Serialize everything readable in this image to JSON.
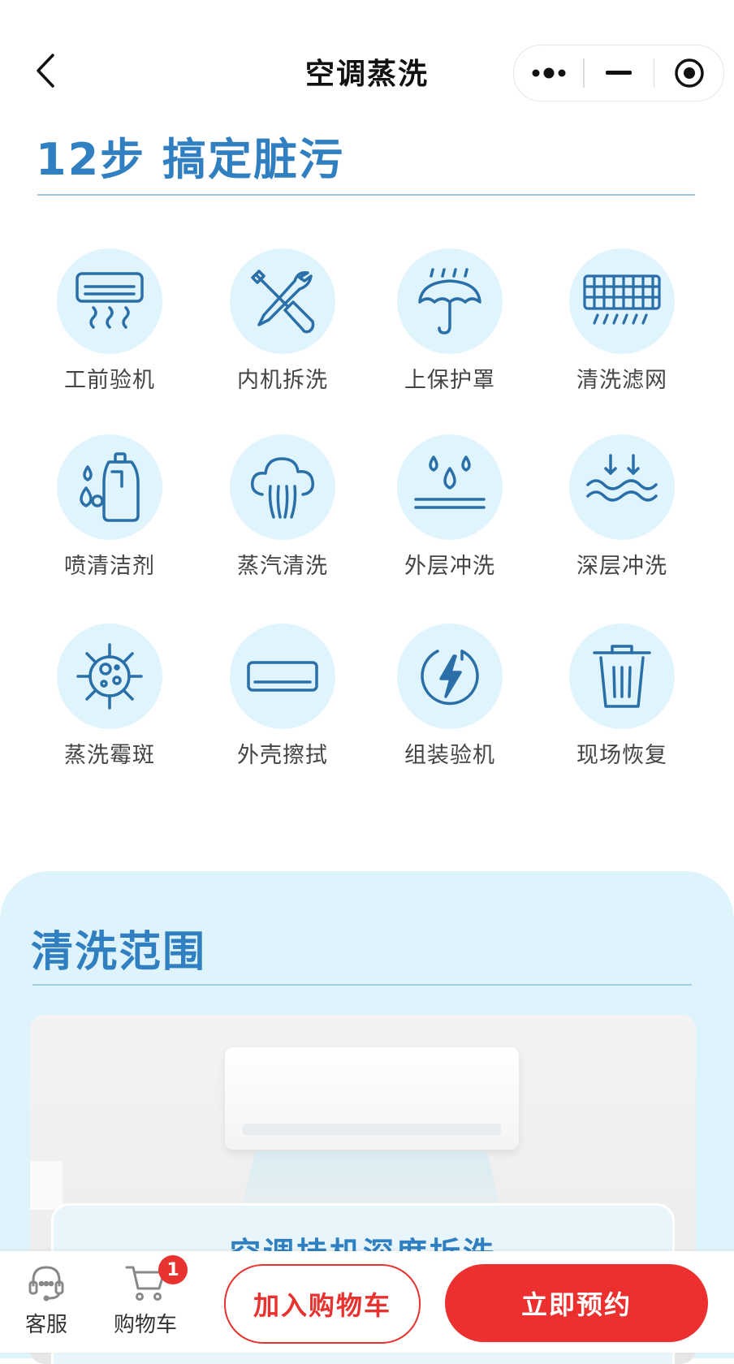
{
  "header": {
    "title": "空调蒸洗",
    "back_icon": "chevron-left-icon",
    "capsule": [
      "more-dots-icon",
      "minimize-icon",
      "target-icon"
    ]
  },
  "steps_section": {
    "title": "12步 搞定脏污",
    "steps": [
      {
        "label": "工前验机",
        "icon": "air-conditioner-heat-icon"
      },
      {
        "label": "内机拆洗",
        "icon": "tools-icon"
      },
      {
        "label": "上保护罩",
        "icon": "umbrella-rain-icon"
      },
      {
        "label": "清洗滤网",
        "icon": "filter-grid-icon"
      },
      {
        "label": "喷清洁剂",
        "icon": "detergent-bottle-icon"
      },
      {
        "label": "蒸汽清洗",
        "icon": "steam-cloud-icon"
      },
      {
        "label": "外层冲洗",
        "icon": "water-drops-icon"
      },
      {
        "label": "深层冲洗",
        "icon": "deep-water-icon"
      },
      {
        "label": "蒸洗霉斑",
        "icon": "mold-virus-icon"
      },
      {
        "label": "外壳擦拭",
        "icon": "ac-panel-icon"
      },
      {
        "label": "组装验机",
        "icon": "power-bolt-icon"
      },
      {
        "label": "现场恢复",
        "icon": "trash-bin-icon"
      }
    ]
  },
  "scope_section": {
    "title": "清洗范围",
    "caption": "空调挂机深度拆洗"
  },
  "bottom_bar": {
    "service_label": "客服",
    "cart_label": "购物车",
    "cart_badge": "1",
    "add_to_cart": "加入购物车",
    "book_now": "立即预约"
  },
  "colors": {
    "accent_blue": "#2f7fc1",
    "icon_circle": "#e0f4fd",
    "scope_bg": "#dff3fd",
    "red": "#ec2f2f"
  }
}
